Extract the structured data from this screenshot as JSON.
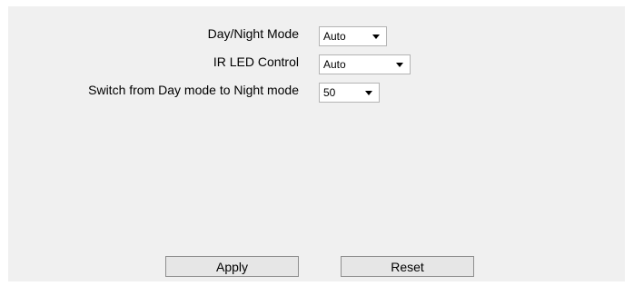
{
  "settings": {
    "rows": [
      {
        "label": "Day/Night Mode",
        "value": "Auto"
      },
      {
        "label": "IR LED Control",
        "value": "Auto"
      },
      {
        "label": "Switch from Day mode to Night mode",
        "value": "50"
      }
    ]
  },
  "buttons": {
    "apply_label": "Apply",
    "reset_label": "Reset"
  }
}
